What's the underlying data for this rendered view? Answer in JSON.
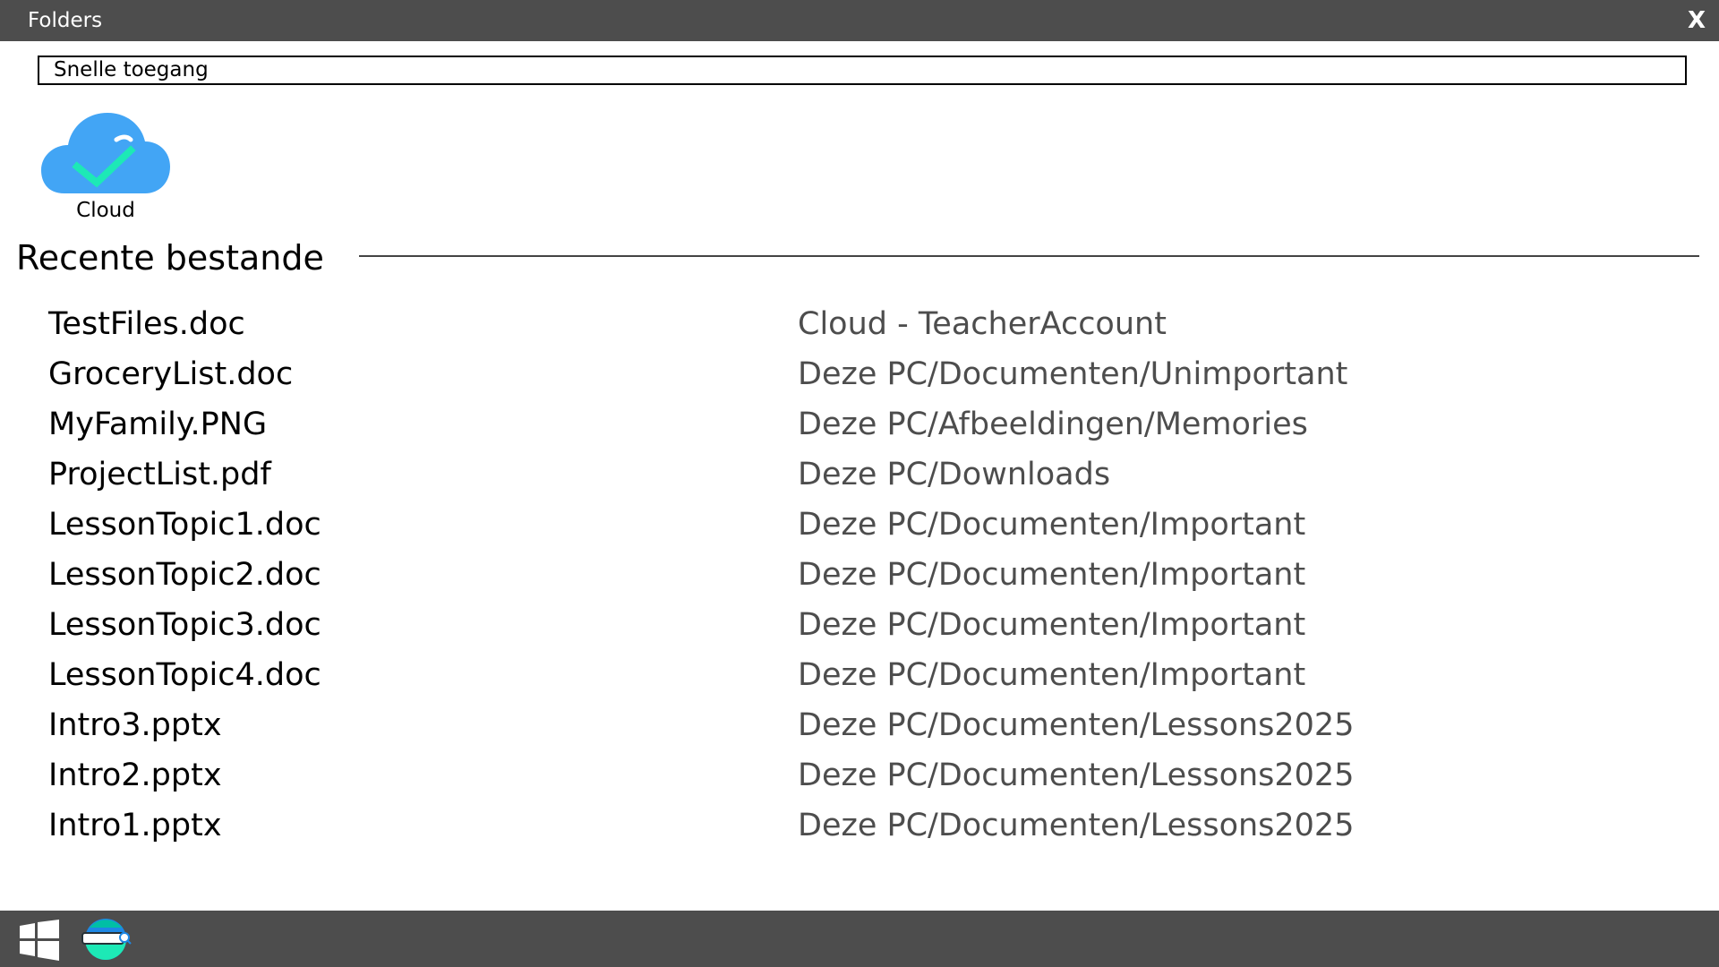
{
  "window": {
    "title": "Folders",
    "close_label": "X"
  },
  "quick_access": {
    "label": "Snelle toegang"
  },
  "cloud": {
    "label": "Cloud",
    "icon": "cloud-check-icon"
  },
  "recent": {
    "heading": "Recente bestande",
    "files": [
      {
        "name": "TestFiles.doc",
        "path": "Cloud - TeacherAccount"
      },
      {
        "name": "GroceryList.doc",
        "path": "Deze PC/Documenten/Unimportant"
      },
      {
        "name": "MyFamily.PNG",
        "path": "Deze PC/Afbeeldingen/Memories"
      },
      {
        "name": "ProjectList.pdf",
        "path": "Deze PC/Downloads"
      },
      {
        "name": "LessonTopic1.doc",
        "path": "Deze PC/Documenten/Important"
      },
      {
        "name": "LessonTopic2.doc",
        "path": "Deze PC/Documenten/Important"
      },
      {
        "name": "LessonTopic3.doc",
        "path": "Deze PC/Documenten/Important"
      },
      {
        "name": "LessonTopic4.doc",
        "path": "Deze PC/Documenten/Important"
      },
      {
        "name": "Intro3.pptx",
        "path": "Deze PC/Documenten/Lessons2025"
      },
      {
        "name": "Intro2.pptx",
        "path": "Deze PC/Documenten/Lessons2025"
      },
      {
        "name": "Intro1.pptx",
        "path": "Deze PC/Documenten/Lessons2025"
      }
    ]
  },
  "taskbar": {
    "start_icon": "windows-logo-icon",
    "search_icon": "search-app-icon"
  },
  "colors": {
    "bar": "#4d4d4d",
    "cloud_blue": "#42a5f5",
    "check_green": "#1de9b6"
  }
}
